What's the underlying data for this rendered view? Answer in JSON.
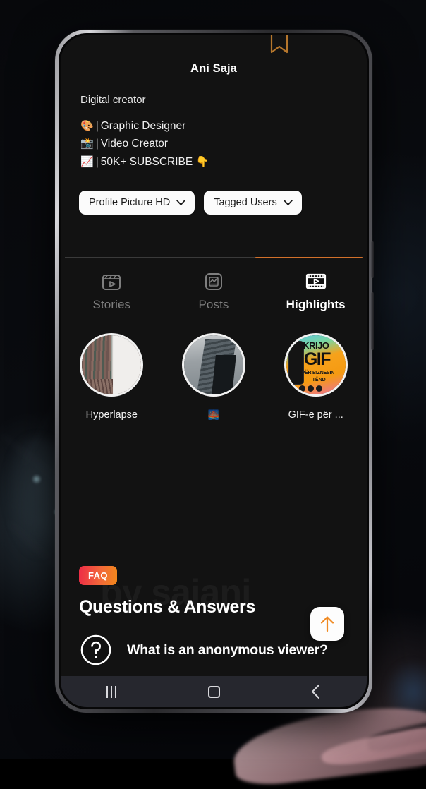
{
  "background": {
    "description": "dark blurred scene with hand holding phone"
  },
  "phone": {
    "bookmark_icon": "bookmark-icon",
    "nav": {
      "recents_label": "recents-icon",
      "home_label": "home-icon",
      "back_label": "back-icon"
    }
  },
  "profile": {
    "name": "Ani Saja",
    "subtitle": "Digital creator",
    "bio_lines": [
      {
        "emoji": "🎨",
        "separator": "|",
        "text": "Graphic Designer"
      },
      {
        "emoji": "📸",
        "separator": "|",
        "text": "Video Creator"
      },
      {
        "emoji": "📈",
        "separator": "|",
        "text": "50K+ SUBSCRIBE",
        "suffix": "👇"
      }
    ]
  },
  "chips": [
    {
      "label": "Profile Picture HD",
      "icon": "chevron-down-icon"
    },
    {
      "label": "Tagged Users",
      "icon": "chevron-down-icon"
    }
  ],
  "tabs": [
    {
      "label": "Stories",
      "icon": "stories-icon",
      "active": false
    },
    {
      "label": "Posts",
      "icon": "posts-icon",
      "active": false
    },
    {
      "label": "Highlights",
      "icon": "highlights-icon",
      "active": true
    }
  ],
  "highlights": [
    {
      "label": "Hyperlapse",
      "art": "building-facade"
    },
    {
      "label": "🌉",
      "art": "skyscraper"
    },
    {
      "label": "GIF-e për ...",
      "art": "gif-promo",
      "art_text": {
        "top": "KRIJO",
        "big": "GIF",
        "sub": "PËR BIZNESIN",
        "sub2": "TËND"
      }
    }
  ],
  "watermark": "by sajani",
  "faq": {
    "badge": "FAQ",
    "title": "Questions & Answers",
    "question_icon": "question-mark-icon",
    "first_question": "What is an anonymous viewer?",
    "scroll_top_icon": "arrow-up-icon"
  },
  "colors": {
    "accent_orange": "#d2702a",
    "screen_bg": "#121212",
    "chip_bg": "#fbfbfb",
    "faq_badge_from": "#ed2b46",
    "faq_badge_to": "#f2891b",
    "navbar_bg": "#26272e"
  }
}
